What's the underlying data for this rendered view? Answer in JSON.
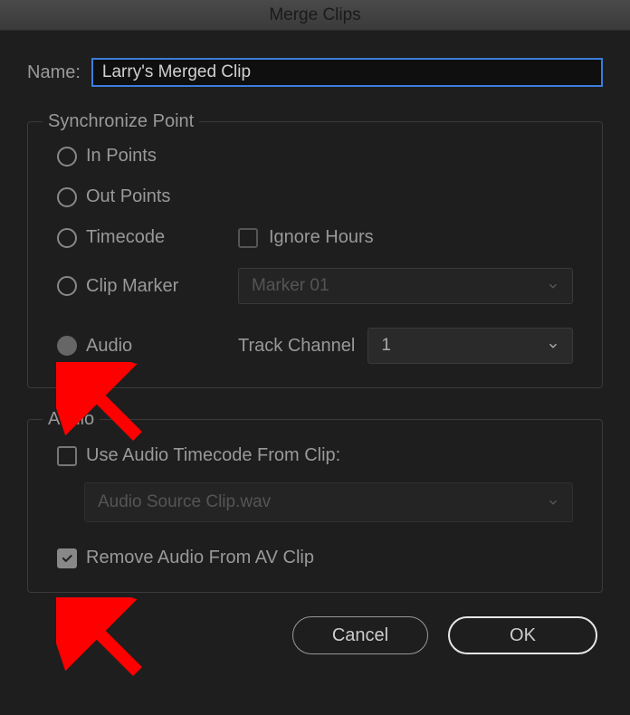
{
  "titlebar": "Merge Clips",
  "name": {
    "label": "Name:",
    "value": "Larry's Merged Clip"
  },
  "syncPoint": {
    "legend": "Synchronize Point",
    "options": {
      "inPoints": "In Points",
      "outPoints": "Out Points",
      "timecode": "Timecode",
      "clipMarker": "Clip Marker",
      "audio": "Audio"
    },
    "ignoreHours": "Ignore Hours",
    "markerSelect": "Marker 01",
    "trackChannel": {
      "label": "Track Channel",
      "value": "1"
    }
  },
  "audio": {
    "legend": "Audio",
    "useTimecodeLabel": "Use Audio Timecode From Clip:",
    "sourceClip": "Audio Source Clip.wav",
    "removeAudioLabel": "Remove Audio From AV Clip"
  },
  "buttons": {
    "cancel": "Cancel",
    "ok": "OK"
  }
}
